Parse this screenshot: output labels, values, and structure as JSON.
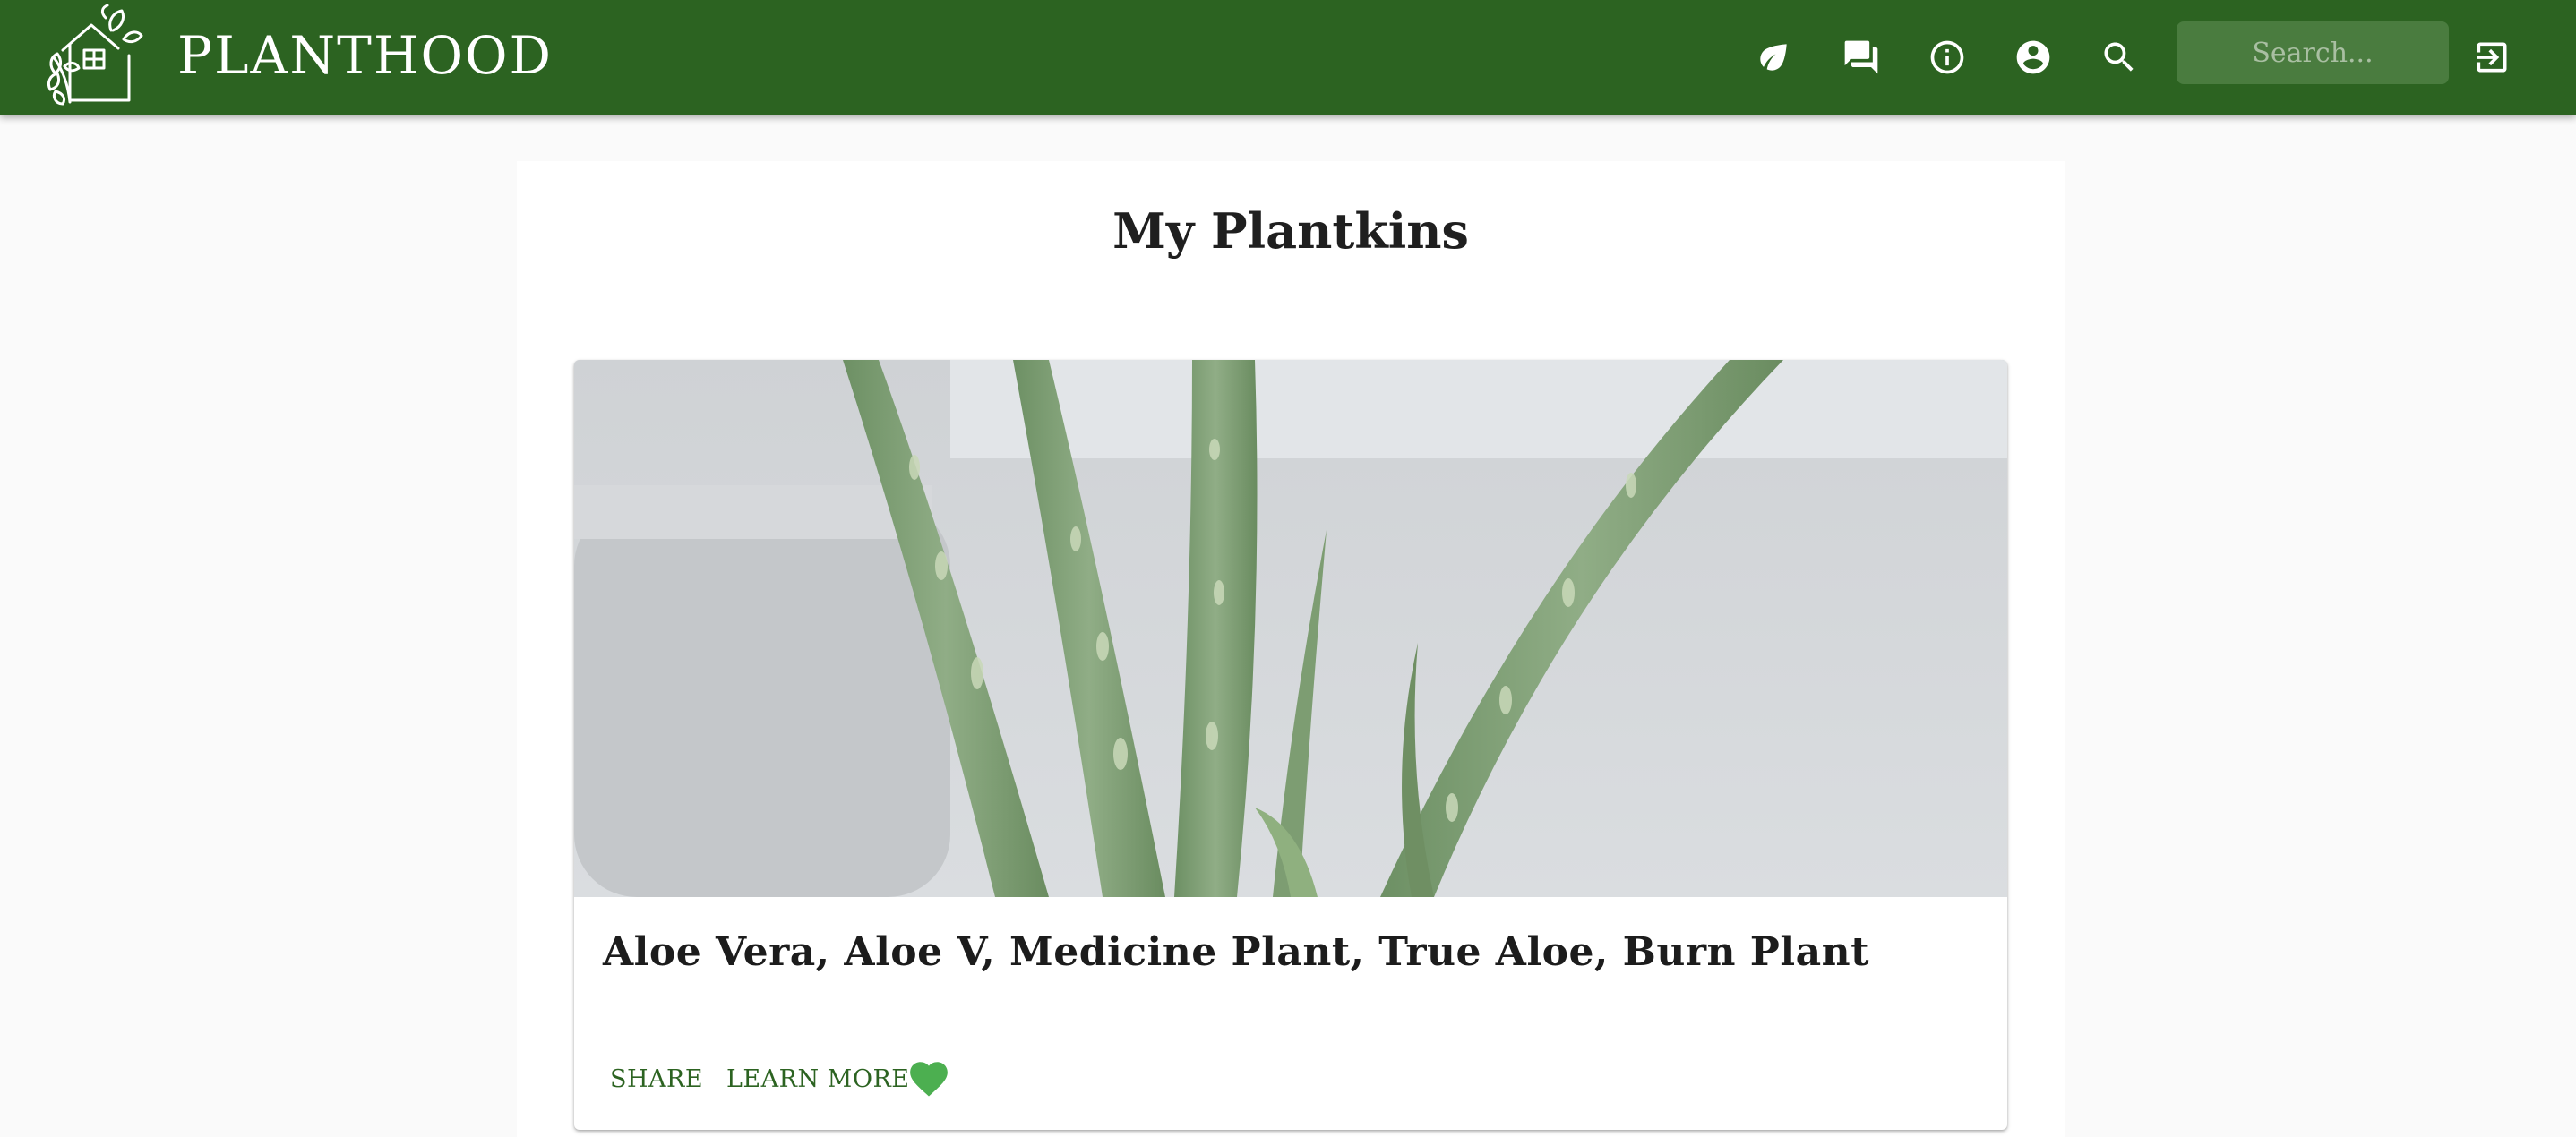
{
  "app": {
    "brand": "PLANTHOOD"
  },
  "header": {
    "nav_icons": [
      "leaf-icon",
      "forum-icon",
      "info-icon",
      "account-circle-icon",
      "search-icon"
    ],
    "search": {
      "placeholder": "Search..."
    },
    "logout_icon": "logout-icon"
  },
  "main": {
    "title": "My Plantkins",
    "cards": [
      {
        "title": "Aloe Vera, Aloe V, Medicine Plant, True Aloe, Burn Plant",
        "actions": {
          "share": "SHARE",
          "learn_more": "LEARN MORE"
        },
        "favorite": true
      }
    ]
  },
  "colors": {
    "appbar": "#2c6321",
    "search_bg": "#4a7c3f",
    "accent_text": "#2c6321",
    "favorite": "#4caf50",
    "page_bg": "#fafafa"
  }
}
